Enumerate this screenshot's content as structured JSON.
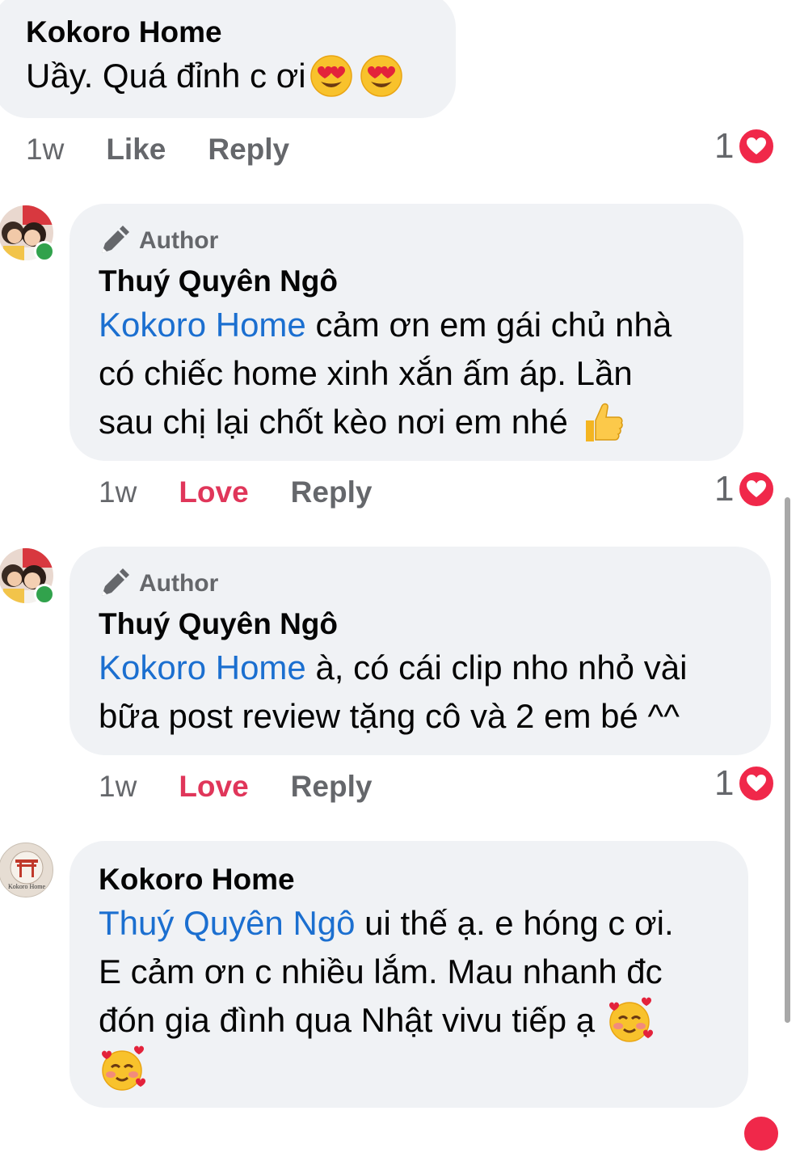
{
  "comments": [
    {
      "author": "Kokoro Home",
      "text": "Uầy. Quá đỉnh c ơi",
      "time": "1w",
      "action1": "Like",
      "reply": "Reply",
      "reaction_count": "1"
    },
    {
      "badge": "Author",
      "author": "Thuý Quyên Ngô",
      "mention": "Kokoro Home",
      "text_line1": " cảm ơn em gái chủ nhà",
      "text_line2": "có chiếc home xinh xắn ấm áp. Lần",
      "text_line3": "sau chị lại chốt kèo nơi em nhé",
      "time": "1w",
      "action1": "Love",
      "reply": "Reply",
      "reaction_count": "1"
    },
    {
      "badge": "Author",
      "author": "Thuý Quyên Ngô",
      "mention": "Kokoro Home",
      "text_line1": " à, có cái clip nho nhỏ vài",
      "text_line2": "bữa post review tặng cô và 2 em bé ^^",
      "time": "1w",
      "action1": "Love",
      "reply": "Reply",
      "reaction_count": "1"
    },
    {
      "author": "Kokoro Home",
      "avatar_text": "Kokoro Home",
      "mention": "Thuý Quyên Ngô",
      "text_line1": " ui thế ạ. e hóng c ơi.",
      "text_line2": "E cảm ơn c nhiều lắm. Mau nhanh đc",
      "text_line3": "đón gia đình qua Nhật vivu tiếp ạ"
    }
  ],
  "colors": {
    "bubble": "#f0f2f5",
    "mention": "#1b6fd0",
    "love": "#e0365a",
    "heart": "#f0284a",
    "muted": "#65676b",
    "online": "#31a24c"
  },
  "icons": [
    "pencil-icon",
    "heart-icon",
    "heart-eyes-emoji",
    "thumbs-up-emoji",
    "smiling-hearts-emoji"
  ]
}
